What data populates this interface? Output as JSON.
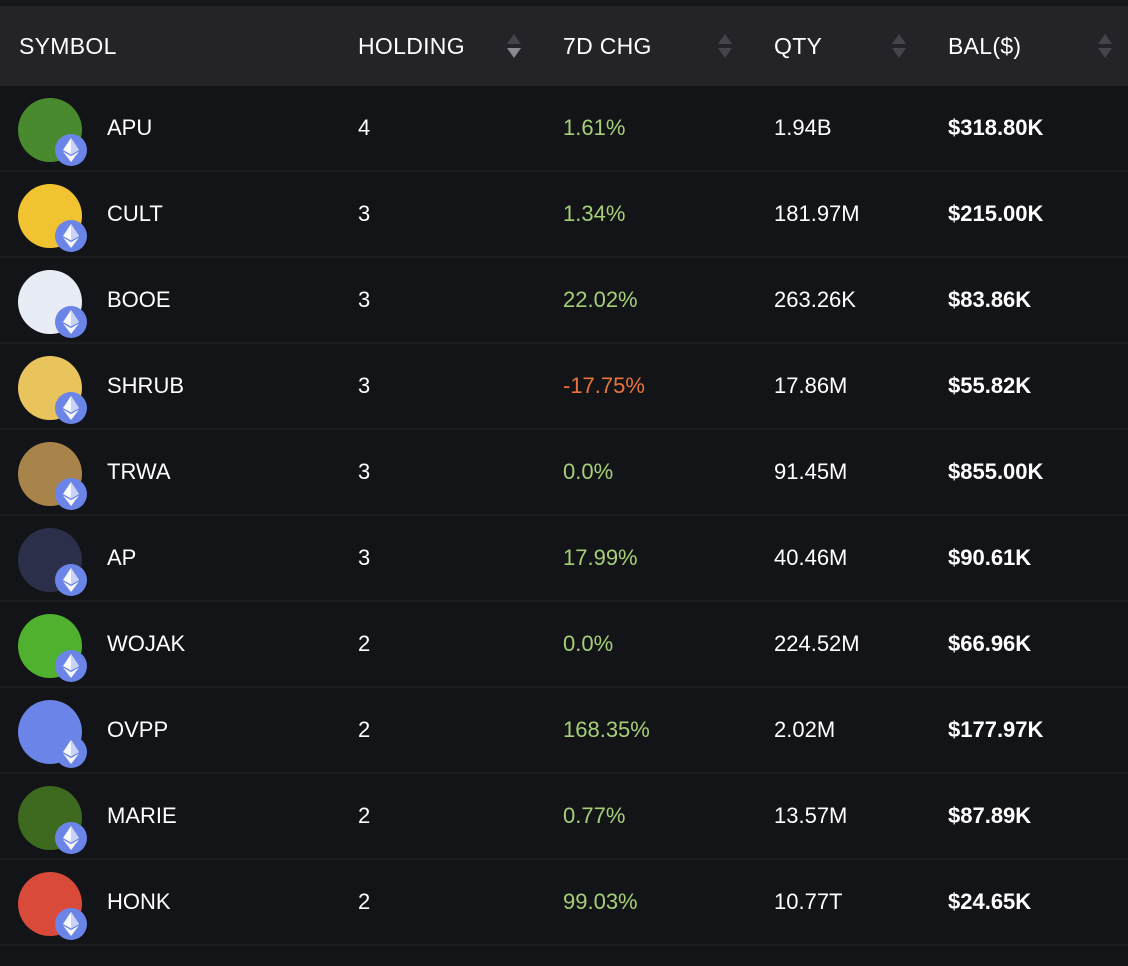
{
  "header": {
    "symbol": "SYMBOL",
    "holding": "HOLDING",
    "chg": "7D CHG",
    "qty": "QTY",
    "bal": "BAL($)"
  },
  "colors": {
    "positive": "#a6cf78",
    "negative": "#e8743b",
    "eth_badge": "#6b84e8"
  },
  "rows": [
    {
      "symbol": "APU",
      "holding": "4",
      "chg": "1.61%",
      "qty": "1.94B",
      "bal": "$318.80K",
      "trend": "pos",
      "avatar": "#4a8a2f"
    },
    {
      "symbol": "CULT",
      "holding": "3",
      "chg": "1.34%",
      "qty": "181.97M",
      "bal": "$215.00K",
      "trend": "pos",
      "avatar": "#f2c331"
    },
    {
      "symbol": "BOOE",
      "holding": "3",
      "chg": "22.02%",
      "qty": "263.26K",
      "bal": "$83.86K",
      "trend": "pos",
      "avatar": "#e8ecf5"
    },
    {
      "symbol": "SHRUB",
      "holding": "3",
      "chg": "-17.75%",
      "qty": "17.86M",
      "bal": "$55.82K",
      "trend": "neg",
      "avatar": "#e9c35c"
    },
    {
      "symbol": "TRWA",
      "holding": "3",
      "chg": "0.0%",
      "qty": "91.45M",
      "bal": "$855.00K",
      "trend": "pos",
      "avatar": "#a9844a"
    },
    {
      "symbol": "AP",
      "holding": "3",
      "chg": "17.99%",
      "qty": "40.46M",
      "bal": "$90.61K",
      "trend": "pos",
      "avatar": "#2c2f4a"
    },
    {
      "symbol": "WOJAK",
      "holding": "2",
      "chg": "0.0%",
      "qty": "224.52M",
      "bal": "$66.96K",
      "trend": "pos",
      "avatar": "#4fb12e"
    },
    {
      "symbol": "OVPP",
      "holding": "2",
      "chg": "168.35%",
      "qty": "2.02M",
      "bal": "$177.97K",
      "trend": "pos",
      "avatar": "#6b84e8"
    },
    {
      "symbol": "MARIE",
      "holding": "2",
      "chg": "0.77%",
      "qty": "13.57M",
      "bal": "$87.89K",
      "trend": "pos",
      "avatar": "#3d6a1e"
    },
    {
      "symbol": "HONK",
      "holding": "2",
      "chg": "99.03%",
      "qty": "10.77T",
      "bal": "$24.65K",
      "trend": "pos",
      "avatar": "#d94a3a"
    }
  ]
}
